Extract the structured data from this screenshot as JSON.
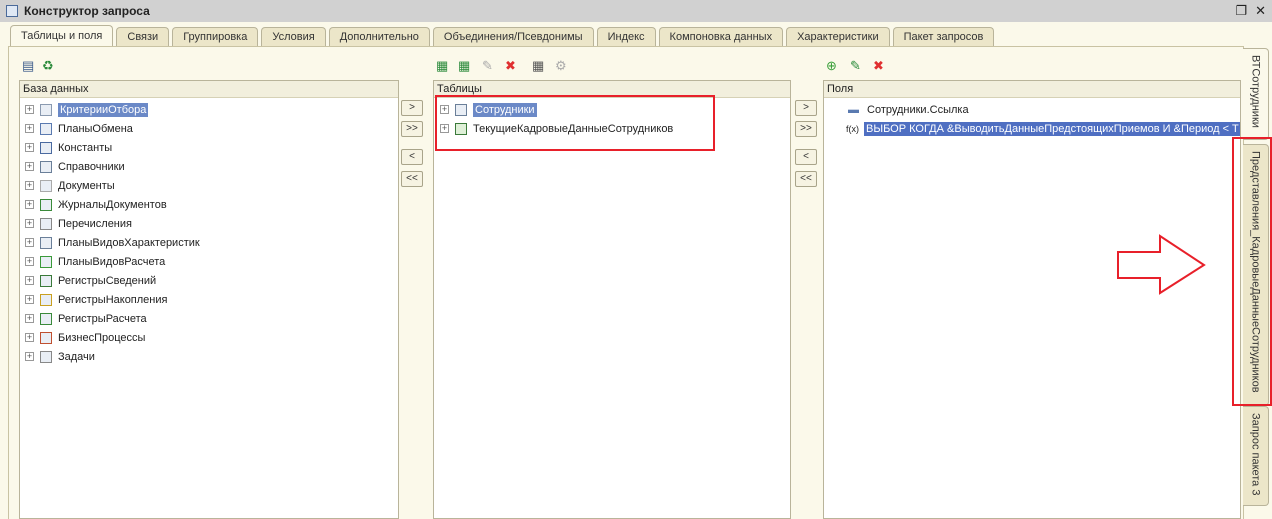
{
  "window": {
    "title": "Конструктор запроса",
    "restore_icon": "restore-icon",
    "close_icon": "close-icon"
  },
  "tabs": [
    "Таблицы и поля",
    "Связи",
    "Группировка",
    "Условия",
    "Дополнительно",
    "Объединения/Псевдонимы",
    "Индекс",
    "Компоновка данных",
    "Характеристики",
    "Пакет запросов"
  ],
  "database": {
    "header": "База данных",
    "items": [
      "КритерииОтбора",
      "ПланыОбмена",
      "Константы",
      "Справочники",
      "Документы",
      "ЖурналыДокументов",
      "Перечисления",
      "ПланыВидовХарактеристик",
      "ПланыВидовРасчета",
      "РегистрыСведений",
      "РегистрыНакопления",
      "РегистрыРасчета",
      "БизнесПроцессы",
      "Задачи"
    ]
  },
  "tables": {
    "header": "Таблицы",
    "items": [
      "Сотрудники",
      "ТекущиеКадровыеДанныеСотрудников"
    ]
  },
  "fields": {
    "header": "Поля",
    "items": [
      "Сотрудники.Ссылка",
      "ВЫБОР КОГДА &ВыводитьДанныеПредстоящихПриемов И &Период < Т"
    ]
  },
  "move_buttons": [
    ">",
    ">>",
    "<",
    "<<"
  ],
  "side_tabs": [
    "ВТСотрудники",
    "Представления_КадровыеДанныеСотрудников",
    "Запрос пакета 3"
  ],
  "colors": {
    "highlight": "#e8202a",
    "selection": "#4f6fc2"
  }
}
